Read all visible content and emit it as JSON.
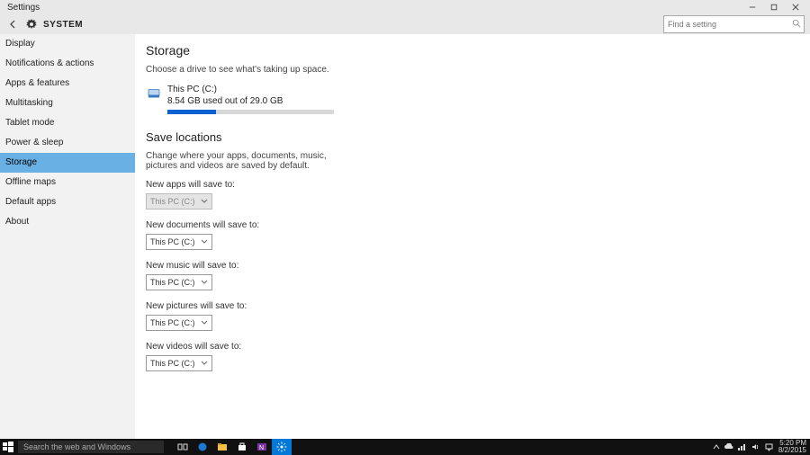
{
  "titlebar": {
    "title": "Settings"
  },
  "header": {
    "category": "SYSTEM",
    "search_placeholder": "Find a setting"
  },
  "sidebar": {
    "items": [
      {
        "label": "Display"
      },
      {
        "label": "Notifications & actions"
      },
      {
        "label": "Apps & features"
      },
      {
        "label": "Multitasking"
      },
      {
        "label": "Tablet mode"
      },
      {
        "label": "Power & sleep"
      },
      {
        "label": "Storage",
        "active": true
      },
      {
        "label": "Offline maps"
      },
      {
        "label": "Default apps"
      },
      {
        "label": "About"
      }
    ]
  },
  "storage": {
    "heading": "Storage",
    "desc": "Choose a drive to see what's taking up space.",
    "drive_name": "This PC (C:)",
    "drive_usage": "8.54 GB used out of 29.0 GB",
    "drive_pct": 29
  },
  "save": {
    "heading": "Save locations",
    "desc": "Change where your apps, documents, music, pictures and videos are saved by default.",
    "rows": [
      {
        "label": "New apps will save to:",
        "value": "This PC (C:)",
        "disabled": true
      },
      {
        "label": "New documents will save to:",
        "value": "This PC (C:)"
      },
      {
        "label": "New music will save to:",
        "value": "This PC (C:)"
      },
      {
        "label": "New pictures will save to:",
        "value": "This PC (C:)"
      },
      {
        "label": "New videos will save to:",
        "value": "This PC (C:)"
      }
    ]
  },
  "taskbar": {
    "search_placeholder": "Search the web and Windows",
    "time": "5:20 PM",
    "date": "8/2/2015"
  }
}
